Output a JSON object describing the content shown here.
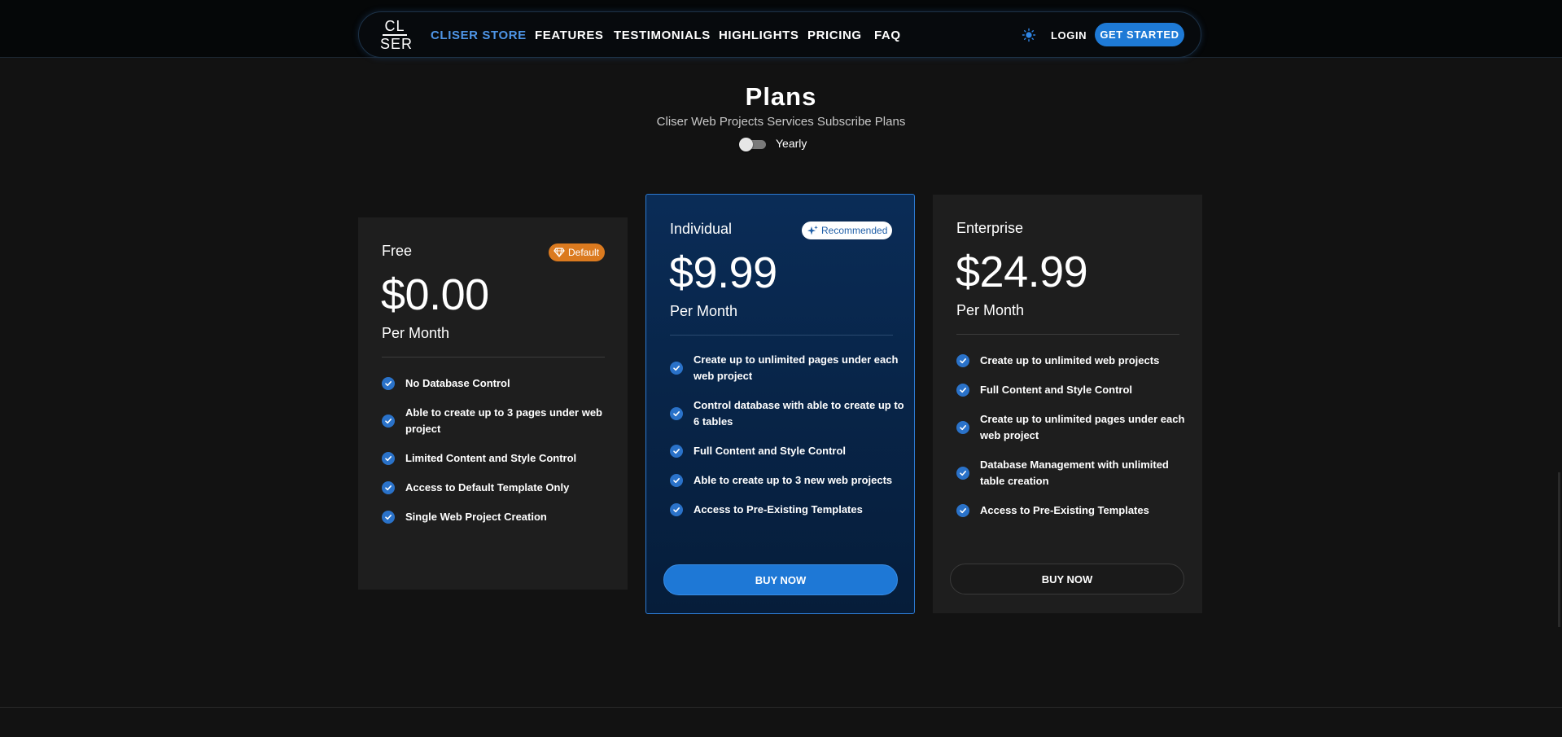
{
  "header": {
    "logo_line1": "CL",
    "logo_line2": "SER",
    "nav": [
      {
        "label": "CLISER STORE",
        "active": true
      },
      {
        "label": "FEATURES"
      },
      {
        "label": "TESTIMONIALS"
      },
      {
        "label": "HIGHLIGHTS"
      },
      {
        "label": "PRICING"
      },
      {
        "label": "FAQ"
      }
    ],
    "theme_icon": "sun-icon",
    "login_label": "LOGIN",
    "get_started_label": "GET STARTED",
    "accent_color": "#1e7ad6"
  },
  "plans_section": {
    "title": "Plans",
    "subtitle": "Cliser Web Projects Services Subscribe Plans",
    "billing_toggle_label": "Yearly",
    "billing_toggle_on": false
  },
  "plans": [
    {
      "name": "Free",
      "badge": "Default",
      "badge_color": "#db7a1f",
      "price": "$0.00",
      "period": "Per Month",
      "features": [
        "No Database Control",
        "Able to create up to 3 pages under web project",
        "Limited Content and Style Control",
        "Access to Default Template Only",
        "Single Web Project Creation"
      ]
    },
    {
      "name": "Individual",
      "badge": "Recommended",
      "price": "$9.99",
      "period": "Per Month",
      "features": [
        "Create up to unlimited pages under each web project",
        "Control database with able to create up to 6 tables",
        "Full Content and Style Control",
        "Able to create up to 3 new web projects",
        "Access to Pre-Existing Templates"
      ],
      "button": "BUY NOW"
    },
    {
      "name": "Enterprise",
      "price": "$24.99",
      "period": "Per Month",
      "features": [
        "Create up to unlimited web projects",
        "Full Content and Style Control",
        "Create up to unlimited pages under each web project",
        "Database Management with unlimited table creation",
        "Access to Pre-Existing Templates"
      ],
      "button": "BUY NOW"
    }
  ]
}
